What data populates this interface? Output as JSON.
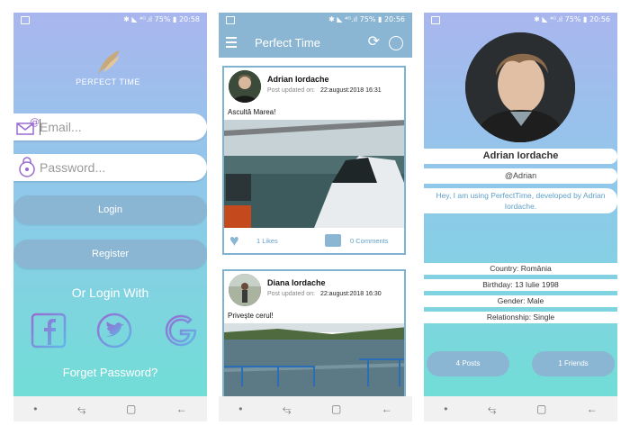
{
  "status_bar": {
    "text": "✱ ◣ ⁴ᴳ.ıl 75% ▮ 20:58",
    "text_feed": "✱ ◣ ⁴ᴳ.ıl 75% ▮ 20:56",
    "text_profile": "✱ ◣ ⁴ᴳ.ıl 75% ▮ 20:56"
  },
  "nav": {
    "dot": "•",
    "recents": "⥃",
    "home": "▢",
    "back": "←"
  },
  "login": {
    "brand": "PERFECT TIME",
    "email_placeholder": "Email...",
    "password_placeholder": "Password...",
    "login_label": "Login",
    "register_label": "Register",
    "or_login_with": "Or Login With",
    "forget_password": "Forget Password?"
  },
  "feed": {
    "title": "Perfect Time",
    "posts": [
      {
        "author": "Adrian Iordache",
        "updated_label": "Post updated on:",
        "date": "22:august:2018  16:31",
        "text": "Ascultă Marea!",
        "likes": "1 Likes",
        "comments": "0 Comments"
      },
      {
        "author": "Diana Iordache",
        "updated_label": "Post updated on:",
        "date": "22:august:2018  16:30",
        "text": "Privește cerul!"
      }
    ]
  },
  "profile": {
    "name": "Adrian Iordache",
    "handle": "@Adrian",
    "bio": "Hey, I am using PerfectTime, developed by Adrian Iordache.",
    "country": "Country: România",
    "birthday": "Birthday: 13 Iulie 1998",
    "gender": "Gender: Male",
    "relationship": "Relationship: Single",
    "posts_btn": "4 Posts",
    "friends_btn": "1 Friends"
  },
  "colors": {
    "accent": "#8bb6d3",
    "gradient_top": "#a9b6ee",
    "gradient_bottom": "#6ee0d4",
    "link": "#5f9fc8"
  }
}
